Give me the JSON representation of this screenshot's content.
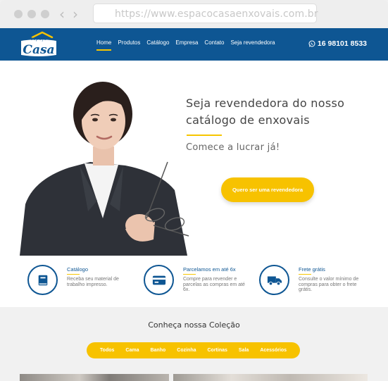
{
  "browser": {
    "url": "https://www.espacocasaenxovais.com.br"
  },
  "header": {
    "logo_text_small": "espaço",
    "logo_text": "Casa",
    "nav": [
      "Home",
      "Produtos",
      "Catálogo",
      "Empresa",
      "Contato",
      "Seja revendedora"
    ],
    "active_nav": "Home",
    "phone": "16 98101 8533"
  },
  "hero": {
    "title": "Seja revendedora do nosso catálogo de enxovais",
    "subtitle": "Comece a lucrar já!",
    "cta_label": "Quero ser uma revendedora"
  },
  "features": [
    {
      "title": "Catálogo",
      "text": "Receba seu material de trabalho impresso.",
      "icon": "book-icon"
    },
    {
      "title": "Parcelamos em até 6x",
      "text": "Compre para revender e parcelas as compras em até 6x.",
      "icon": "credit-card-icon"
    },
    {
      "title": "Frete grátis",
      "text": "Consulte o valor mínimo de compras para obter o frete grátis.",
      "icon": "truck-icon"
    }
  ],
  "collection": {
    "title": "Conheça nossa Coleção",
    "filters": [
      "Todos",
      "Cama",
      "Banho",
      "Cozinha",
      "Cortinas",
      "Sala",
      "Acessórios"
    ]
  },
  "colors": {
    "primary": "#0e5693",
    "accent": "#f7c200"
  }
}
